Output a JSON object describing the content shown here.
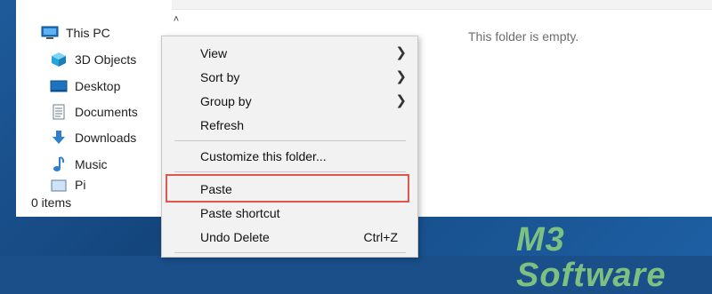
{
  "nav": {
    "collapse_glyph": "˄",
    "items": [
      {
        "label": "This PC",
        "icon": "computer-icon"
      },
      {
        "label": "3D Objects",
        "icon": "cube-icon"
      },
      {
        "label": "Desktop",
        "icon": "desktop-icon"
      },
      {
        "label": "Documents",
        "icon": "document-icon"
      },
      {
        "label": "Downloads",
        "icon": "download-icon"
      },
      {
        "label": "Music",
        "icon": "music-icon"
      },
      {
        "label": "Pi",
        "icon": "pictures-icon"
      }
    ]
  },
  "status": {
    "items_count": "0 items"
  },
  "content": {
    "empty_message": "This folder is empty."
  },
  "context_menu": {
    "items": [
      {
        "label": "View",
        "submenu": true
      },
      {
        "label": "Sort by",
        "submenu": true
      },
      {
        "label": "Group by",
        "submenu": true
      },
      {
        "label": "Refresh"
      },
      {
        "label": "Customize this folder..."
      },
      {
        "label": "Paste",
        "highlighted": true
      },
      {
        "label": "Paste shortcut"
      },
      {
        "label": "Undo Delete",
        "shortcut": "Ctrl+Z"
      }
    ],
    "submenu_glyph": "❯"
  },
  "watermark": {
    "text": "M3 Software"
  },
  "colors": {
    "highlight_border": "#e2574c",
    "menu_bg": "#f2f2f2",
    "accent_blue": "#1e73be"
  }
}
